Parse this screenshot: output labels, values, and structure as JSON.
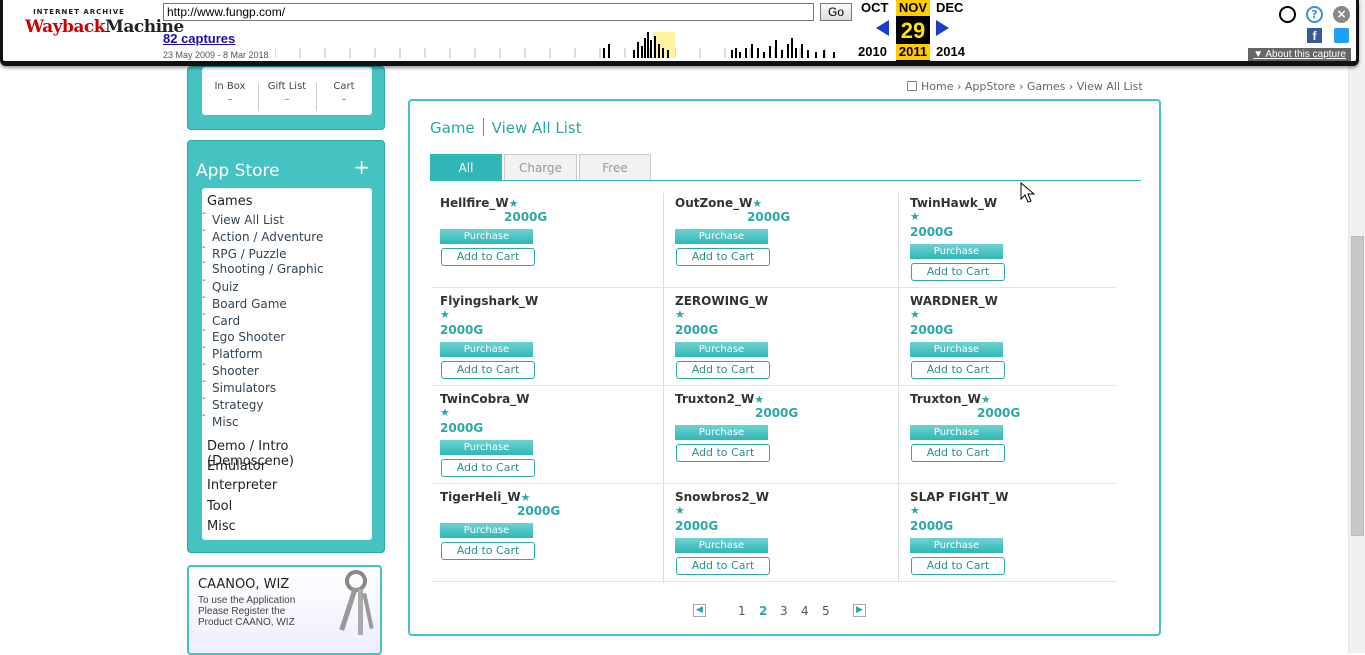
{
  "wayback": {
    "logo_top": "INTERNET ARCHIVE",
    "logo_main_a": "Wayback",
    "logo_main_b": "Machine",
    "url": "http://www.fungp.com/",
    "go_label": "Go",
    "captures": "82 captures",
    "range": "23 May 2009 - 8 Mar 2018",
    "prev_month": "OCT",
    "cur_month": "NOV",
    "next_month": "DEC",
    "cur_day": "29",
    "prev_year": "2010",
    "cur_year": "2011",
    "next_year": "2014",
    "about": "About this capture",
    "accent": "#ffcc00"
  },
  "mybox": {
    "cols": [
      {
        "label": "In Box",
        "value": "–"
      },
      {
        "label": "Gift List",
        "value": "–"
      },
      {
        "label": "Cart",
        "value": "–"
      }
    ]
  },
  "appstore": {
    "title": "App Store",
    "plus": "+",
    "games_head": "Games",
    "sub_items": [
      "View All List",
      "Action / Adventure",
      "RPG / Puzzle",
      "Shooting / Graphic",
      "Quiz",
      "Board Game",
      "Card",
      "Ego Shooter",
      "Platform",
      "Shooter",
      "Simulators",
      "Strategy",
      "Misc"
    ],
    "other_cats": [
      "Demo / Intro (Demoscene)",
      "Emulator",
      "Interpreter",
      "Tool",
      "Misc"
    ]
  },
  "caanoo": {
    "title": "CAANOO, WIZ",
    "desc1": "To use the Application",
    "desc2": "Please Register the",
    "desc3": "Product CAANO, WIZ"
  },
  "breadcrumb": [
    "Home",
    "AppStore",
    "Games",
    "View All List"
  ],
  "main": {
    "title": "Game",
    "subtitle": "View All List",
    "tabs": [
      "All",
      "Charge",
      "Free"
    ],
    "purchase_label": "Purchase",
    "cart_label": "Add to Cart",
    "games": [
      {
        "name": "Hellfire_W",
        "price": "2000G"
      },
      {
        "name": "OutZone_W",
        "price": "2000G"
      },
      {
        "name": "TwinHawk_W",
        "price": "2000G"
      },
      {
        "name": "Flyingshark_W",
        "price": "2000G"
      },
      {
        "name": "ZEROWING_W",
        "price": "2000G"
      },
      {
        "name": "WARDNER_W",
        "price": "2000G"
      },
      {
        "name": "TwinCobra_W",
        "price": "2000G"
      },
      {
        "name": "Truxton2_W",
        "price": "2000G"
      },
      {
        "name": "Truxton_W",
        "price": "2000G"
      },
      {
        "name": "TigerHeli_W",
        "price": "2000G"
      },
      {
        "name": "Snowbros2_W",
        "price": "2000G"
      },
      {
        "name": "SLAP FIGHT_W",
        "price": "2000G"
      }
    ],
    "pages": [
      "1",
      "2",
      "3",
      "4",
      "5"
    ],
    "current_page": "2"
  }
}
